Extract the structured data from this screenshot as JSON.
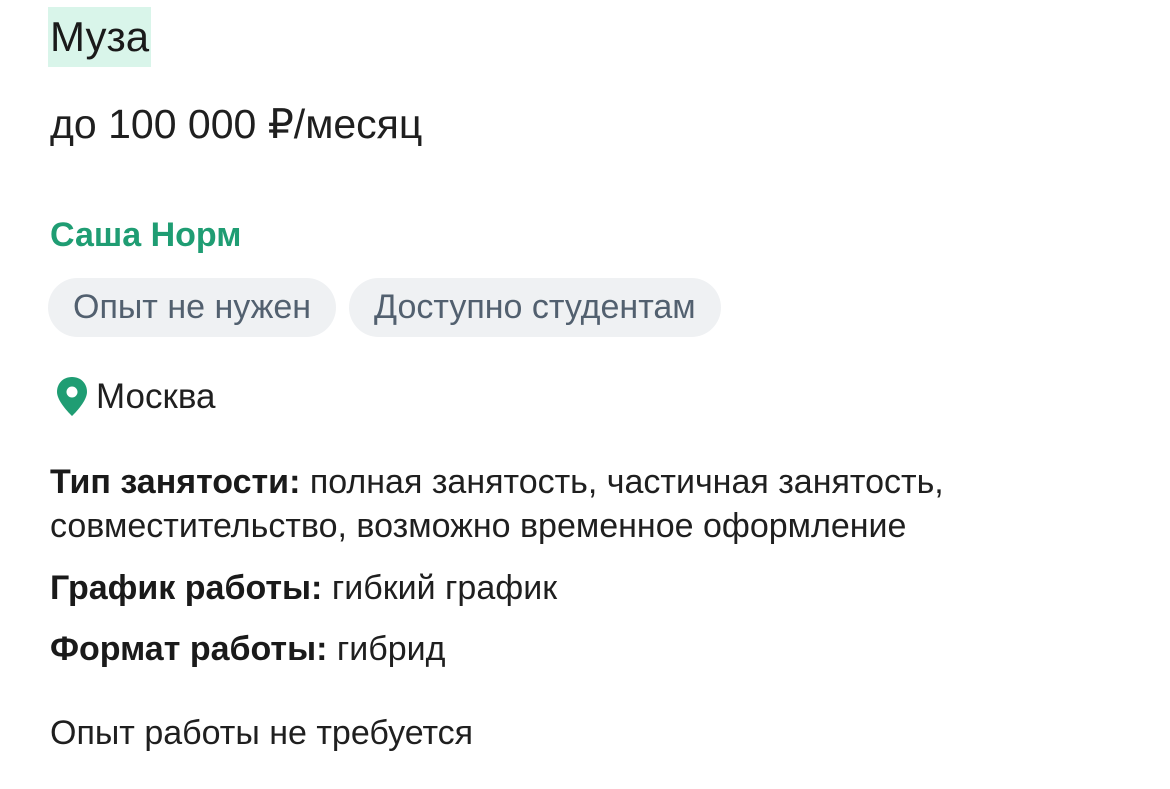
{
  "vacancy": {
    "title": "Муза",
    "salary": "до 100 000 ₽/месяц",
    "company": "Саша Норм",
    "tags": [
      "Опыт не нужен",
      "Доступно студентам"
    ],
    "location": {
      "icon": "location-pin-icon",
      "city": "Москва"
    },
    "details": {
      "employment_label": "Тип занятости:",
      "employment_value": "полная занятость, частичная занятость, совместительство, возможно временное оформление",
      "schedule_label": "График работы:",
      "schedule_value": "гибкий график",
      "format_label": "Формат работы:",
      "format_value": "гибрид"
    },
    "experience": "Опыт работы не требуется"
  },
  "colors": {
    "accent": "#1f9d73",
    "title_highlight": "#d9f5ea",
    "chip_background": "#eff1f3",
    "chip_text": "#52606f"
  }
}
